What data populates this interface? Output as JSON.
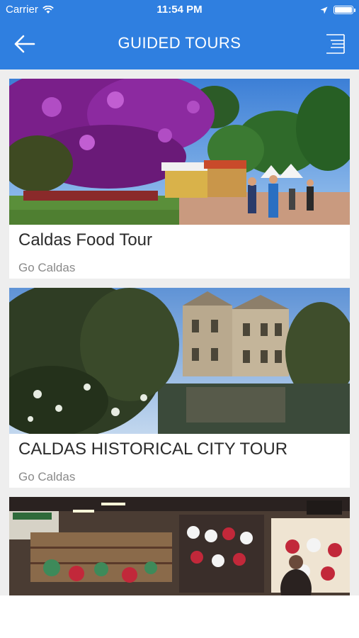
{
  "status_bar": {
    "carrier": "Carrier",
    "time": "11:54 PM",
    "battery_level": 1.0
  },
  "navbar": {
    "title": "GUIDED TOURS",
    "back_icon": "arrow-left-icon",
    "menu_icon": "menu-icon"
  },
  "tours": [
    {
      "title": "Caldas Food Tour",
      "subtitle": "Go Caldas"
    },
    {
      "title": "CALDAS HISTORICAL CITY TOUR",
      "subtitle": "Go Caldas"
    },
    {
      "title": "",
      "subtitle": ""
    }
  ],
  "colors": {
    "accent": "#2f7fe0",
    "background": "#eeeeee",
    "card": "#ffffff"
  }
}
